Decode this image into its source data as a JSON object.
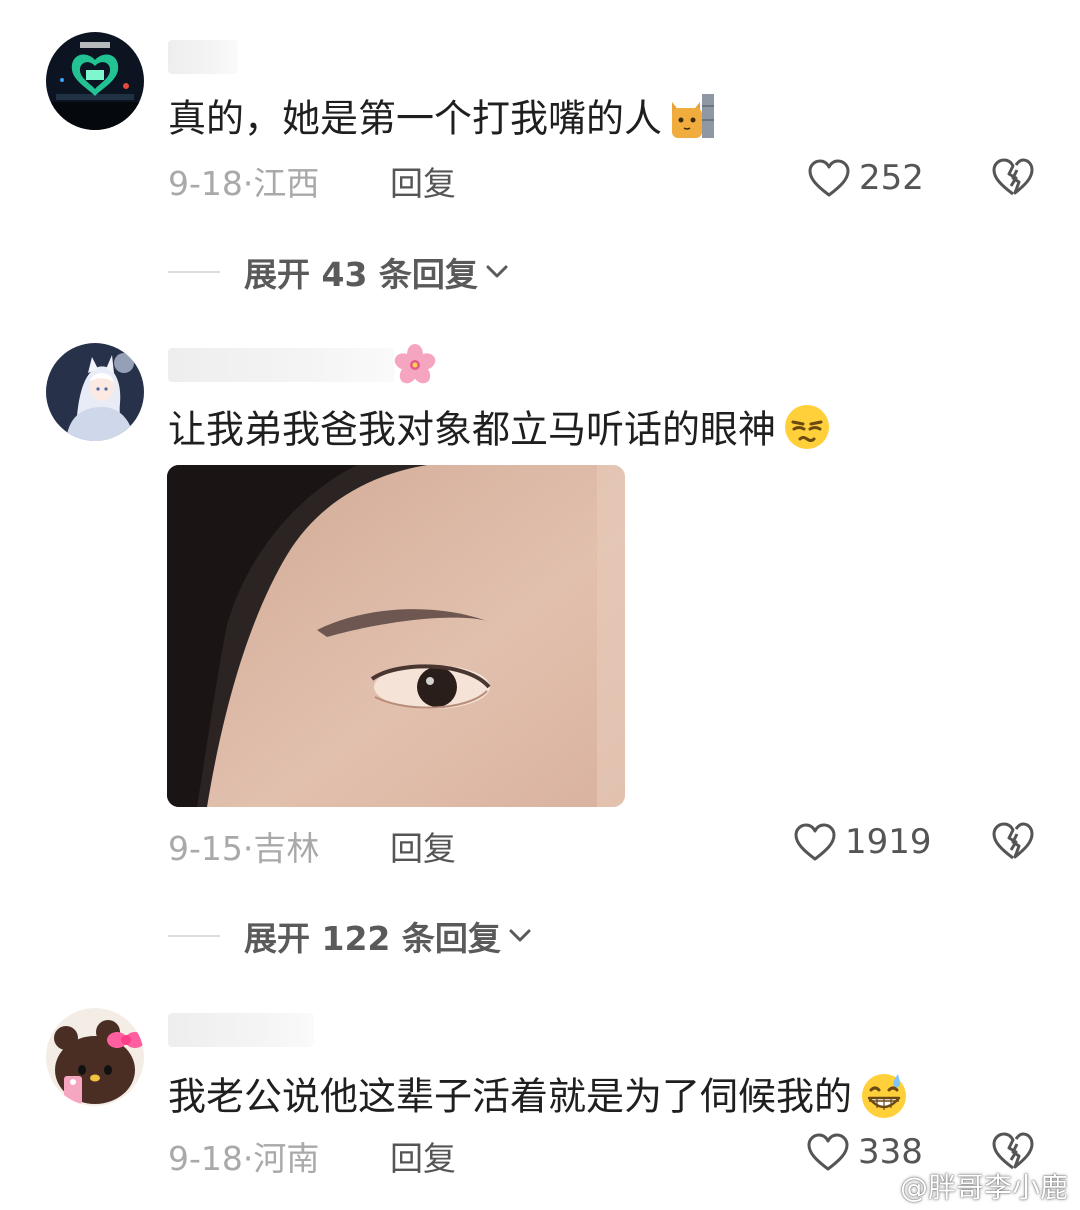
{
  "comments": [
    {
      "text": "真的，她是第一个打我嘴的人",
      "emoji": "cat-peeking-emoji",
      "date": "9-18",
      "region": "江西",
      "reply_label": "回复",
      "likes": "252",
      "expand_label": "展开 43 条回复"
    },
    {
      "text": "让我弟我爸我对象都立马听话的眼神",
      "emoji": "annoyed-face-emoji",
      "name_badge": "cherry-blossom-emoji",
      "date": "9-15",
      "region": "吉林",
      "reply_label": "回复",
      "likes": "1919",
      "expand_label": "展开 122 条回复"
    },
    {
      "text": "我老公说他这辈子活着就是为了伺候我的",
      "emoji": "grinning-sweat-emoji",
      "date": "9-18",
      "region": "河南",
      "reply_label": "回复",
      "likes": "338"
    }
  ],
  "watermark": {
    "text": "@胖哥李小鹿",
    "icon": "weibo-icon"
  },
  "colors": {
    "text": "#1f1f1f",
    "meta": "#a9a9a9",
    "action": "#555555"
  }
}
